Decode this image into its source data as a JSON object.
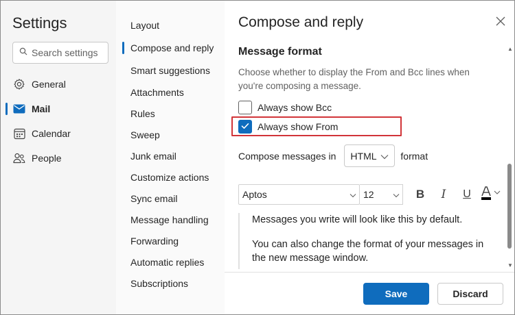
{
  "settings": {
    "title": "Settings",
    "search_placeholder": "Search settings",
    "nav": [
      {
        "label": "General",
        "icon": "gear-icon"
      },
      {
        "label": "Mail",
        "icon": "mail-icon"
      },
      {
        "label": "Calendar",
        "icon": "calendar-icon"
      },
      {
        "label": "People",
        "icon": "people-icon"
      }
    ],
    "selected_nav": "Mail"
  },
  "mail_menu": {
    "items": [
      "Layout",
      "Compose and reply",
      "Smart suggestions",
      "Attachments",
      "Rules",
      "Sweep",
      "Junk email",
      "Customize actions",
      "Sync email",
      "Message handling",
      "Forwarding",
      "Automatic replies",
      "Subscriptions"
    ],
    "selected": "Compose and reply"
  },
  "panel": {
    "title": "Compose and reply",
    "section_title": "Message format",
    "section_desc": "Choose whether to display the From and Bcc lines when you're composing a message.",
    "checkbox_bcc": {
      "label": "Always show Bcc",
      "checked": false
    },
    "checkbox_from": {
      "label": "Always show From",
      "checked": true
    },
    "compose_prefix": "Compose messages in",
    "compose_format": "HTML",
    "compose_suffix": "format",
    "font_name": "Aptos",
    "font_size": "12",
    "toolbar": {
      "bold": "B",
      "italic": "I",
      "underline": "U"
    },
    "preview_line1": "Messages you write will look like this by default.",
    "preview_line2": "You can also change the format of your messages in the new message window.",
    "save_label": "Save",
    "discard_label": "Discard"
  },
  "colors": {
    "accent": "#0f6cbd",
    "highlight": "#d13438"
  }
}
